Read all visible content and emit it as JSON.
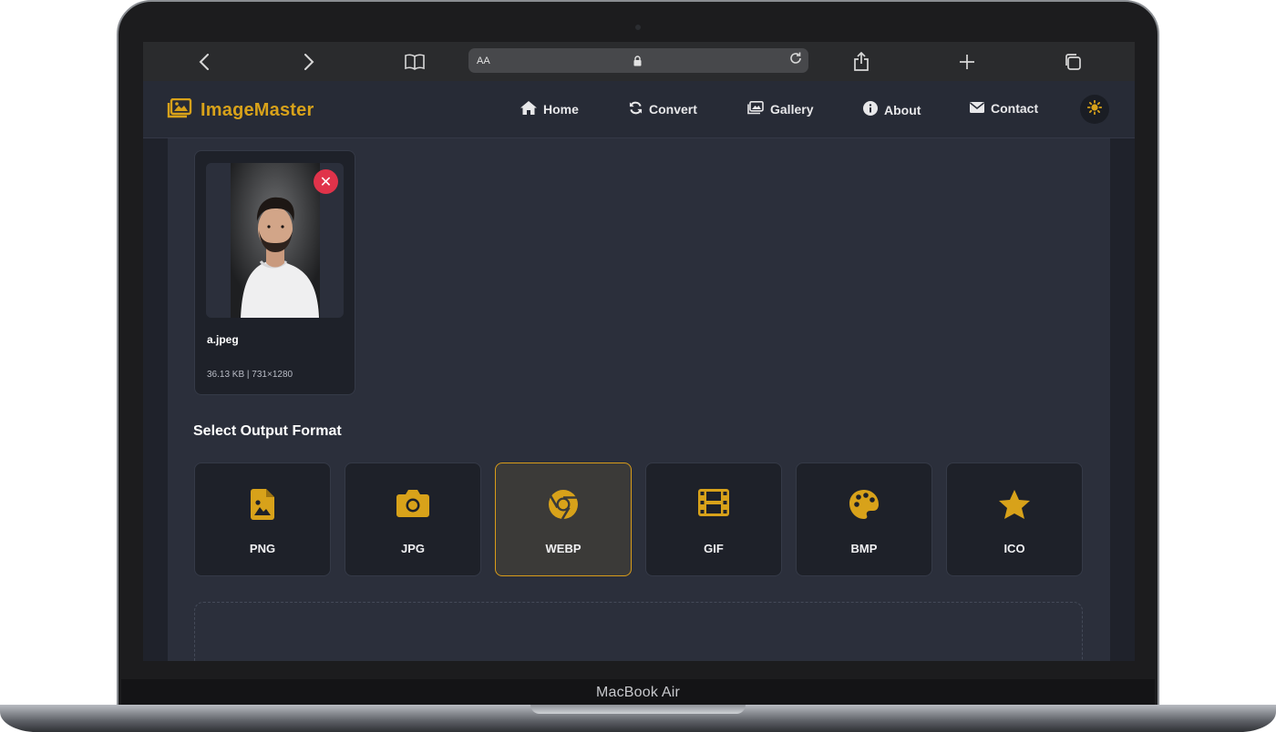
{
  "device": {
    "label": "MacBook Air"
  },
  "browser": {
    "address_prefix": "AA"
  },
  "app": {
    "name": "ImageMaster",
    "accent": "#d8a21a",
    "nav": [
      {
        "label": "Home",
        "icon": "home-icon"
      },
      {
        "label": "Convert",
        "icon": "sync-icon"
      },
      {
        "label": "Gallery",
        "icon": "images-icon"
      },
      {
        "label": "About",
        "icon": "info-icon"
      },
      {
        "label": "Contact",
        "icon": "envelope-icon"
      }
    ]
  },
  "upload": {
    "file_name": "a.jpeg",
    "file_meta": "36.13 KB | 731×1280"
  },
  "output": {
    "title": "Select Output Format",
    "selected": "WEBP",
    "formats": [
      {
        "label": "PNG",
        "icon": "file-image-icon"
      },
      {
        "label": "JPG",
        "icon": "camera-icon"
      },
      {
        "label": "WEBP",
        "icon": "chrome-icon"
      },
      {
        "label": "GIF",
        "icon": "film-icon"
      },
      {
        "label": "BMP",
        "icon": "palette-icon"
      },
      {
        "label": "ICO",
        "icon": "star-icon"
      }
    ]
  }
}
